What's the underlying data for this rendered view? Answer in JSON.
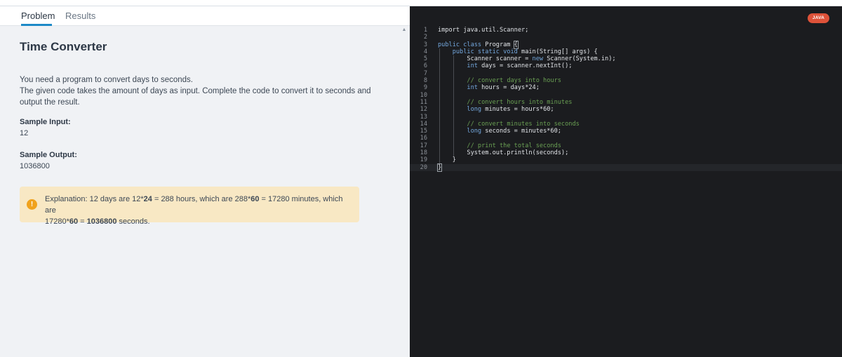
{
  "tabs": {
    "problem": "Problem",
    "results": "Results"
  },
  "problem": {
    "title": "Time Converter",
    "description": [
      "You need a program to convert days to seconds.",
      "The given code takes the amount of days as input. Complete the code to convert it to seconds and",
      "output the result."
    ],
    "sample_input_label": "Sample Input:",
    "sample_input_value": "12",
    "sample_output_label": "Sample Output:",
    "sample_output_value": "1036800",
    "explanation": {
      "icon": "exclamation-icon",
      "p1": "Explanation: 12 days are 12*",
      "b1": "24",
      "p2": " = 288 hours, which are 288*",
      "b2": "60",
      "p3": " = 17280 minutes, which are",
      "p4": "17280*",
      "b3": "60",
      "p5": " = ",
      "b4": "1036800",
      "p6": " seconds."
    }
  },
  "editor": {
    "language_badge": "JAVA",
    "colors": {
      "background": "#1b1c1f",
      "keyword": "#74a8de",
      "comment": "#6aa053",
      "text": "#e0e3e7",
      "badge": "#de5239"
    },
    "current_line": 20,
    "lines": [
      [
        {
          "t": "import java.util.Scanner;"
        }
      ],
      [],
      [
        {
          "t": "public class ",
          "c": "kw"
        },
        {
          "t": "Program "
        },
        {
          "t": "{",
          "c": "hb"
        }
      ],
      [
        {
          "t": "    "
        },
        {
          "t": "public static void ",
          "c": "kw"
        },
        {
          "t": "main(String[] args) {"
        }
      ],
      [
        {
          "t": "        Scanner scanner = "
        },
        {
          "t": "new ",
          "c": "kw"
        },
        {
          "t": "Scanner(System.in);"
        }
      ],
      [
        {
          "t": "        "
        },
        {
          "t": "int ",
          "c": "kw"
        },
        {
          "t": "days = scanner.nextInt();"
        }
      ],
      [],
      [
        {
          "t": "        "
        },
        {
          "t": "// convert days into hours",
          "c": "cm"
        }
      ],
      [
        {
          "t": "        "
        },
        {
          "t": "int ",
          "c": "kw"
        },
        {
          "t": "hours = days*24;"
        }
      ],
      [],
      [
        {
          "t": "        "
        },
        {
          "t": "// convert hours into minutes",
          "c": "cm"
        }
      ],
      [
        {
          "t": "        "
        },
        {
          "t": "long ",
          "c": "kw"
        },
        {
          "t": "minutes = hours*60;"
        }
      ],
      [],
      [
        {
          "t": "        "
        },
        {
          "t": "// convert minutes into seconds",
          "c": "cm"
        }
      ],
      [
        {
          "t": "        "
        },
        {
          "t": "long ",
          "c": "kw"
        },
        {
          "t": "seconds = minutes*60;"
        }
      ],
      [],
      [
        {
          "t": "        "
        },
        {
          "t": "// print the total seconds",
          "c": "cm"
        }
      ],
      [
        {
          "t": "        System.out.println(seconds);"
        }
      ],
      [
        {
          "t": "    }"
        }
      ],
      [
        {
          "t": "}",
          "c": "hb"
        }
      ]
    ]
  }
}
